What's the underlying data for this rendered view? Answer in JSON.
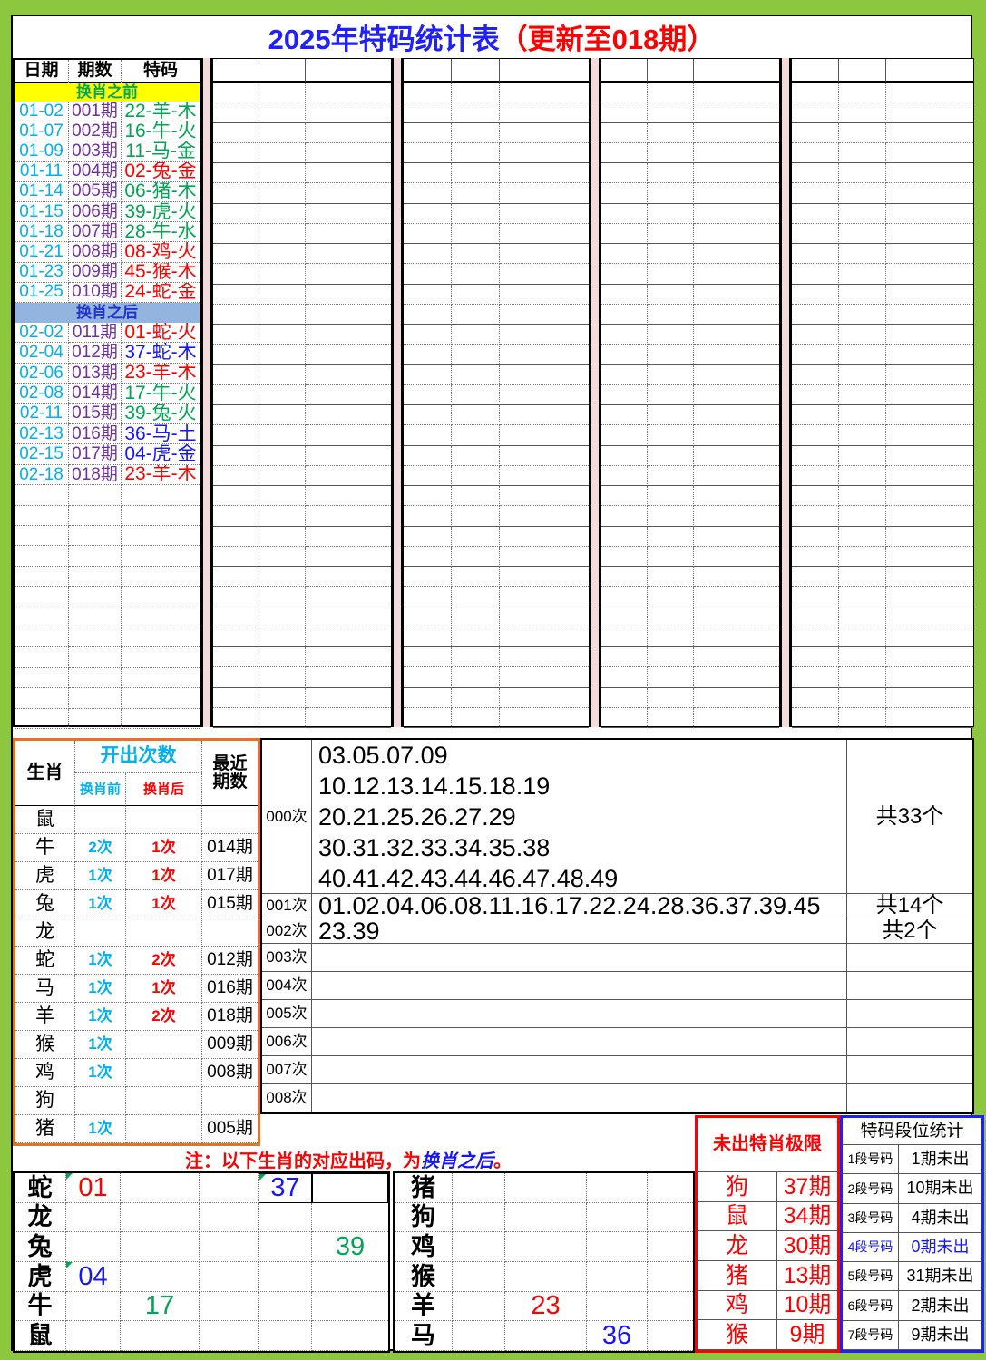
{
  "title": {
    "main": "2025年特码统计表",
    "suffix": "（更新至018期）"
  },
  "colors": {
    "page_green": "#8DC63F",
    "title_blue": "#2020FF",
    "accent_red": "#FF0000",
    "date_cyan": "#00B0F0",
    "period_purple": "#7030A0",
    "wave_green": "#00A651",
    "wave_blue": "#1515FF",
    "yellow_section_bg": "#FFFF00",
    "blue_section_bg": "#92B4DE",
    "pink_separator": "#F2DCDB",
    "orange_border": "#E8731A"
  },
  "top_table": {
    "headers": [
      "日期",
      "期数",
      "特码"
    ],
    "section_before": "换肖之前",
    "section_after": "换肖之后",
    "rows_before": [
      {
        "date": "01-02",
        "period": "001期",
        "code": "22-羊-木",
        "color": "green"
      },
      {
        "date": "01-07",
        "period": "002期",
        "code": "16-牛-火",
        "color": "green"
      },
      {
        "date": "01-09",
        "period": "003期",
        "code": "11-马-金",
        "color": "green"
      },
      {
        "date": "01-11",
        "period": "004期",
        "code": "02-兔-金",
        "color": "red"
      },
      {
        "date": "01-14",
        "period": "005期",
        "code": "06-猪-木",
        "color": "green"
      },
      {
        "date": "01-15",
        "period": "006期",
        "code": "39-虎-火",
        "color": "green"
      },
      {
        "date": "01-18",
        "period": "007期",
        "code": "28-牛-水",
        "color": "green"
      },
      {
        "date": "01-21",
        "period": "008期",
        "code": "08-鸡-火",
        "color": "red"
      },
      {
        "date": "01-23",
        "period": "009期",
        "code": "45-猴-木",
        "color": "red"
      },
      {
        "date": "01-25",
        "period": "010期",
        "code": "24-蛇-金",
        "color": "red"
      }
    ],
    "rows_after": [
      {
        "date": "02-02",
        "period": "011期",
        "code": "01-蛇-火",
        "color": "red"
      },
      {
        "date": "02-04",
        "period": "012期",
        "code": "37-蛇-木",
        "color": "blue"
      },
      {
        "date": "02-06",
        "period": "013期",
        "code": "23-羊-木",
        "color": "red"
      },
      {
        "date": "02-08",
        "period": "014期",
        "code": "17-牛-火",
        "color": "green"
      },
      {
        "date": "02-11",
        "period": "015期",
        "code": "39-兔-火",
        "color": "green"
      },
      {
        "date": "02-13",
        "period": "016期",
        "code": "36-马-土",
        "color": "blue"
      },
      {
        "date": "02-15",
        "period": "017期",
        "code": "04-虎-金",
        "color": "blue"
      },
      {
        "date": "02-18",
        "period": "018期",
        "code": "23-羊-木",
        "color": "red"
      }
    ],
    "empty_rows": 12,
    "empty_groups": 4
  },
  "zodiac_table": {
    "header": {
      "zodiac": "生肖",
      "times": "开出次数",
      "before": "换肖前",
      "after": "换肖后",
      "recent": "最近\n期数"
    },
    "rows": [
      {
        "zodiac": "鼠",
        "before": "",
        "after": "",
        "recent": ""
      },
      {
        "zodiac": "牛",
        "before": "2次",
        "after": "1次",
        "recent": "014期"
      },
      {
        "zodiac": "虎",
        "before": "1次",
        "after": "1次",
        "recent": "017期"
      },
      {
        "zodiac": "兔",
        "before": "1次",
        "after": "1次",
        "recent": "015期"
      },
      {
        "zodiac": "龙",
        "before": "",
        "after": "",
        "recent": ""
      },
      {
        "zodiac": "蛇",
        "before": "1次",
        "after": "2次",
        "recent": "012期"
      },
      {
        "zodiac": "马",
        "before": "1次",
        "after": "1次",
        "recent": "016期"
      },
      {
        "zodiac": "羊",
        "before": "1次",
        "after": "2次",
        "recent": "018期"
      },
      {
        "zodiac": "猴",
        "before": "1次",
        "after": "",
        "recent": "009期"
      },
      {
        "zodiac": "鸡",
        "before": "1次",
        "after": "",
        "recent": "008期"
      },
      {
        "zodiac": "狗",
        "before": "",
        "after": "",
        "recent": ""
      },
      {
        "zodiac": "猪",
        "before": "1次",
        "after": "",
        "recent": "005期"
      }
    ]
  },
  "count_table": {
    "rows": [
      {
        "label": "000次",
        "numbers": [
          "03.05.07.09",
          "10.12.13.14.15.18.19",
          "20.21.25.26.27.29",
          "30.31.32.33.34.35.38",
          "40.41.42.43.44.46.47.48.49"
        ],
        "total": "共33个"
      },
      {
        "label": "001次",
        "numbers": [
          "01.02.04.06.08.11.16.17.22.24.28.36.37.39.45"
        ],
        "total": "共14个"
      },
      {
        "label": "002次",
        "numbers": [
          "23.39"
        ],
        "total": "共2个"
      },
      {
        "label": "003次",
        "numbers": [],
        "total": ""
      },
      {
        "label": "004次",
        "numbers": [],
        "total": ""
      },
      {
        "label": "005次",
        "numbers": [],
        "total": ""
      },
      {
        "label": "006次",
        "numbers": [],
        "total": ""
      },
      {
        "label": "007次",
        "numbers": [],
        "total": ""
      },
      {
        "label": "008次",
        "numbers": [],
        "total": ""
      }
    ]
  },
  "note": {
    "prefix": "注：以下生肖的对应出码，为",
    "highlight": "换肖之后",
    "suffix": "。"
  },
  "bottom_left_table": {
    "rows": [
      {
        "zodiac": "蛇",
        "cells": [
          "01",
          "",
          "",
          "37",
          ""
        ],
        "colors": [
          "red",
          "",
          "",
          "blue",
          ""
        ],
        "markers": [
          true,
          false,
          false,
          true,
          false
        ],
        "boxed": [
          false,
          false,
          false,
          true,
          true
        ]
      },
      {
        "zodiac": "龙",
        "cells": [
          "",
          "",
          "",
          "",
          ""
        ],
        "colors": [
          "",
          "",
          "",
          "",
          ""
        ],
        "markers": [
          false,
          false,
          false,
          false,
          false
        ],
        "boxed": [
          false,
          false,
          false,
          false,
          false
        ]
      },
      {
        "zodiac": "兔",
        "cells": [
          "",
          "",
          "",
          "",
          "39"
        ],
        "colors": [
          "",
          "",
          "",
          "",
          "green"
        ],
        "markers": [
          false,
          false,
          false,
          false,
          false
        ],
        "boxed": [
          false,
          false,
          false,
          false,
          false
        ]
      },
      {
        "zodiac": "虎",
        "cells": [
          "04",
          "",
          "",
          "",
          ""
        ],
        "colors": [
          "blue",
          "",
          "",
          "",
          ""
        ],
        "markers": [
          true,
          false,
          false,
          false,
          false
        ],
        "boxed": [
          false,
          false,
          false,
          false,
          false
        ]
      },
      {
        "zodiac": "牛",
        "cells": [
          "",
          "17",
          "",
          "",
          ""
        ],
        "colors": [
          "",
          "green",
          "",
          "",
          ""
        ],
        "markers": [
          false,
          false,
          false,
          false,
          false
        ],
        "boxed": [
          false,
          false,
          false,
          false,
          false
        ]
      },
      {
        "zodiac": "鼠",
        "cells": [
          "",
          "",
          "",
          "",
          ""
        ],
        "colors": [
          "",
          "",
          "",
          "",
          ""
        ],
        "markers": [
          false,
          false,
          false,
          false,
          false
        ],
        "boxed": [
          false,
          false,
          false,
          false,
          false
        ]
      }
    ]
  },
  "bottom_middle_table": {
    "rows": [
      {
        "zodiac": "猪",
        "cells": [
          "",
          "",
          "",
          ""
        ],
        "colors": [
          "",
          "",
          "",
          ""
        ]
      },
      {
        "zodiac": "狗",
        "cells": [
          "",
          "",
          "",
          ""
        ],
        "colors": [
          "",
          "",
          "",
          ""
        ]
      },
      {
        "zodiac": "鸡",
        "cells": [
          "",
          "",
          "",
          ""
        ],
        "colors": [
          "",
          "",
          "",
          ""
        ]
      },
      {
        "zodiac": "猴",
        "cells": [
          "",
          "",
          "",
          ""
        ],
        "colors": [
          "",
          "",
          "",
          ""
        ]
      },
      {
        "zodiac": "羊",
        "cells": [
          "",
          "23",
          "",
          ""
        ],
        "colors": [
          "",
          "red",
          "",
          ""
        ]
      },
      {
        "zodiac": "马",
        "cells": [
          "",
          "",
          "36",
          ""
        ],
        "colors": [
          "",
          "",
          "blue",
          ""
        ]
      }
    ]
  },
  "limit_box": {
    "title": "未出特肖极限",
    "rows": [
      {
        "zodiac": "狗",
        "value": "37期"
      },
      {
        "zodiac": "鼠",
        "value": "34期"
      },
      {
        "zodiac": "龙",
        "value": "30期"
      },
      {
        "zodiac": "猪",
        "value": "13期"
      },
      {
        "zodiac": "鸡",
        "value": "10期"
      },
      {
        "zodiac": "猴",
        "value": "9期"
      }
    ]
  },
  "segment_box": {
    "title": "特码段位统计",
    "rows": [
      {
        "label": "1段号码",
        "value": "1期未出",
        "highlight": false
      },
      {
        "label": "2段号码",
        "value": "10期未出",
        "highlight": false
      },
      {
        "label": "3段号码",
        "value": "4期未出",
        "highlight": false
      },
      {
        "label": "4段号码",
        "value": "0期未出",
        "highlight": true
      },
      {
        "label": "5段号码",
        "value": "31期未出",
        "highlight": false
      },
      {
        "label": "6段号码",
        "value": "2期未出",
        "highlight": false
      },
      {
        "label": "7段号码",
        "value": "9期未出",
        "highlight": false
      }
    ]
  }
}
